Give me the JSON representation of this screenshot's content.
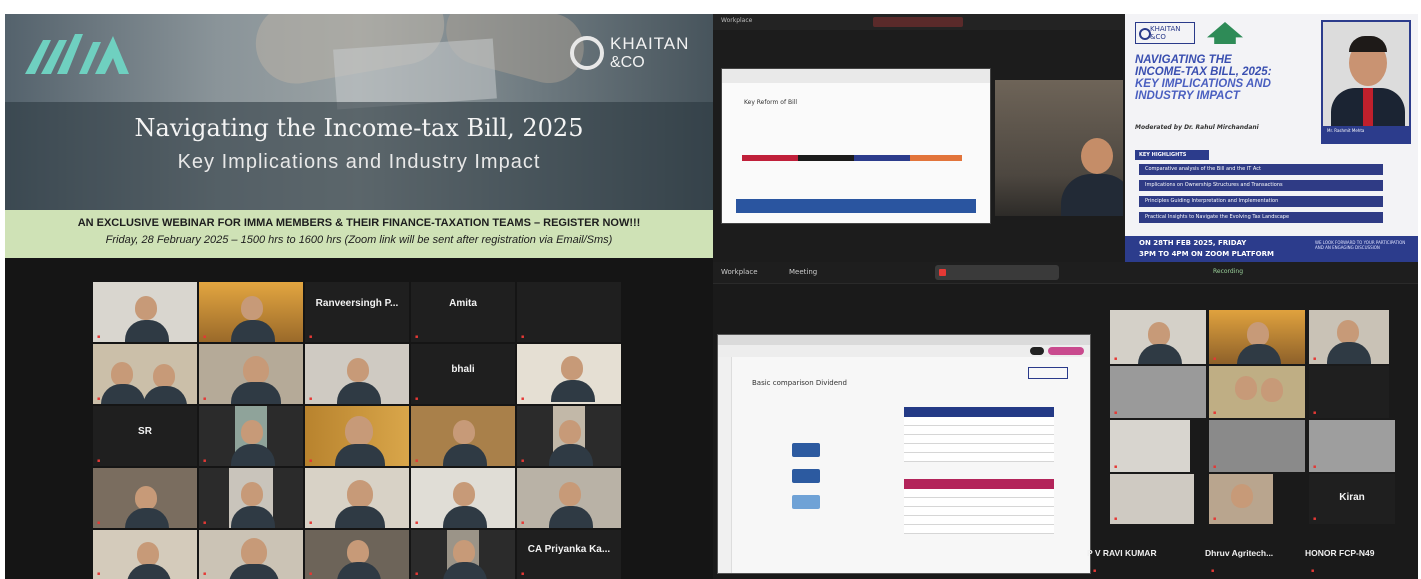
{
  "left_panel": {
    "banner": {
      "imma_logo": "IMMA",
      "khaitan_logo_line1": "KHAITAN",
      "khaitan_logo_line2": "&CO",
      "title": "Navigating the Income-tax Bill, 2025",
      "subtitle": "Key Implications and Industry Impact"
    },
    "promo": {
      "line1": "AN EXCLUSIVE WEBINAR FOR IMMA MEMBERS & THEIR FINANCE-TAXATION TEAMS – REGISTER NOW!!!",
      "line2": "Friday, 28 February 2025 – 1500 hrs to 1600 hrs (Zoom link will be sent after registration via Email/Sms)"
    },
    "gallery": {
      "name_tiles": {
        "ranveersingh": "Ranveersingh P...",
        "amita": "Amita",
        "bhali": "bhali",
        "sr": "SR",
        "ca_priyanka": "CA Priyanka Ka..."
      }
    }
  },
  "right_top": {
    "app_label": "Workplace",
    "share_title": "Key Reform of Bill",
    "poster": {
      "khaitan_line1": "KHAITAN",
      "khaitan_line2": "&CO",
      "title_line1": "NAVIGATING THE",
      "title_line2": "INCOME-TAX BILL, 2025:",
      "title_line3": "KEY IMPLICATIONS AND",
      "title_line4": "INDUSTRY IMPACT",
      "moderator": "Moderated by Dr. Rahul Mirchandani",
      "key_highlights": "KEY HIGHLIGHTS",
      "highlights": [
        "Comparative analysis of the Bill and the IT Act",
        "Implications on Ownership Structures and Transactions",
        "Principles Guiding Interpretation and Implementation",
        "Practical Insights to Navigate the Evolving Tax Landscape"
      ],
      "footer_line1": "ON 28TH FEB 2025, FRIDAY",
      "footer_line2": "3PM TO 4PM ON ZOOM PLATFORM",
      "footer_note": "WE LOOK FORWARD TO YOUR PARTICIPATION AND AN ENGAGING DISCUSSION",
      "speaker_caption": "Mr. Rashmit Mehta"
    }
  },
  "right_bottom": {
    "topbar": {
      "app_label": "Workplace",
      "meeting_label": "Meeting",
      "recording_label": "Recording"
    },
    "doc_title": "Basic comparison Dividend",
    "names": {
      "pv_ravi": "P V RAVI KUMAR",
      "dhruv": "Dhruv Agritech...",
      "honor": "HONOR FCP-N49",
      "kiran": "Kiran"
    }
  },
  "colors": {
    "promo_bg": "#cfe2b6",
    "poster_blue": "#2c3c8c",
    "active_speaker": "#58c36a",
    "muted_red": "#e53935"
  }
}
